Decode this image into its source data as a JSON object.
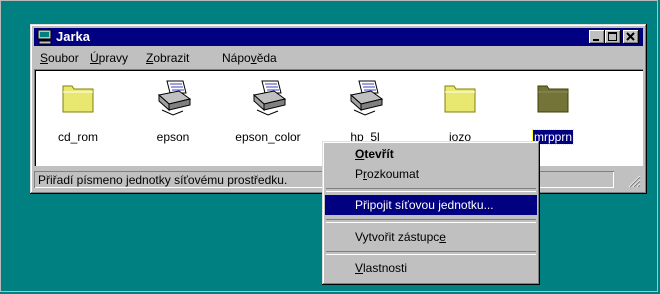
{
  "window": {
    "title": "Jarka"
  },
  "menu": [
    {
      "pre": "",
      "u": "S",
      "post": "oubor"
    },
    {
      "pre": "",
      "u": "Ú",
      "post": "pravy"
    },
    {
      "pre": "",
      "u": "Z",
      "post": "obrazit"
    },
    {
      "pre": "Nápo",
      "u": "v",
      "post": "ěda"
    }
  ],
  "files": [
    {
      "label": "cd_rom",
      "icon": "folder-icon"
    },
    {
      "label": "epson",
      "icon": "printer-icon"
    },
    {
      "label": "epson_color",
      "icon": "printer-icon"
    },
    {
      "label": "hp_5l",
      "icon": "printer-icon"
    },
    {
      "label": "jozo",
      "icon": "folder-icon"
    },
    {
      "label": "mrpprn",
      "icon": "folder-icon",
      "selected": true
    }
  ],
  "status": {
    "text": "Přiřadí písmeno jednotky síťovému prostředku."
  },
  "context_menu": [
    {
      "pre": "",
      "u": "O",
      "post": "tevřít",
      "default": true
    },
    {
      "pre": "P",
      "u": "r",
      "post": "ozkoumat"
    },
    {
      "pre": "Připojit síťovou ",
      "u": "j",
      "post": "ednotku...",
      "highlighted": true
    },
    {
      "pre": "Vytvořit zástupc",
      "u": "e",
      "post": ""
    },
    {
      "pre": "",
      "u": "V",
      "post": "lastnosti"
    }
  ],
  "colors": {
    "desktop": "#008080",
    "titlebar": "#000080",
    "face": "#c0c0c0",
    "highlight": "#000080"
  }
}
